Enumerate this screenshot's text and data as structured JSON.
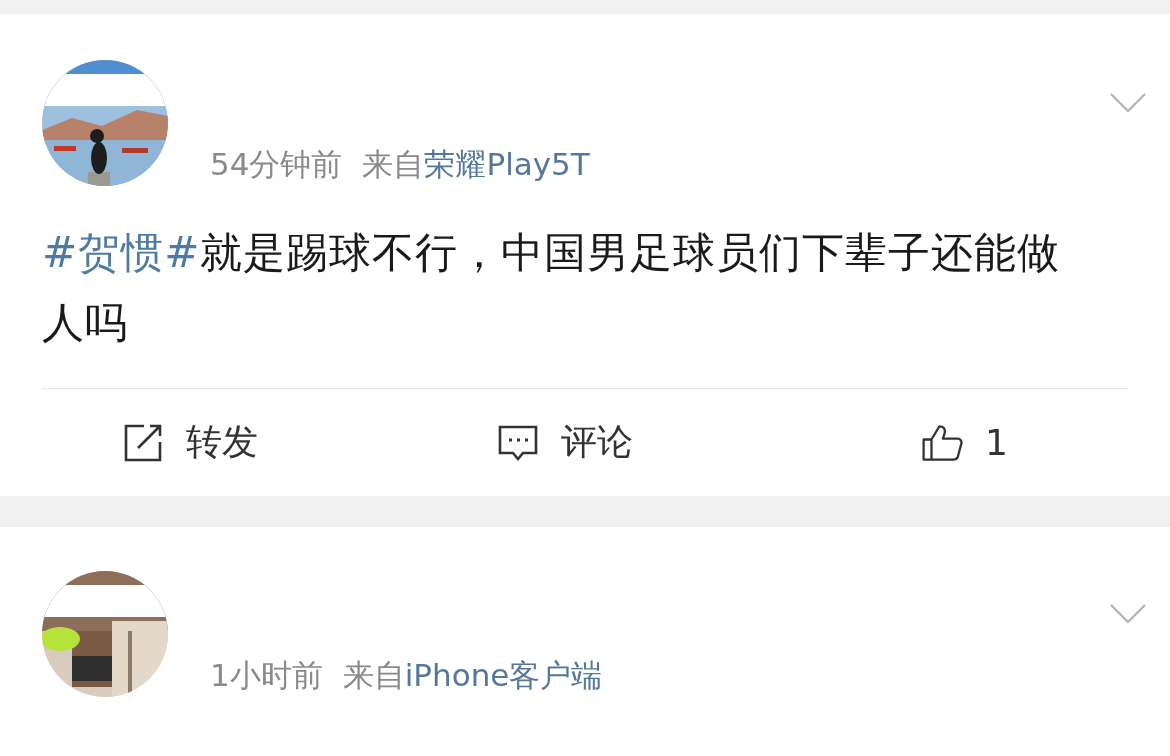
{
  "posts": [
    {
      "time": "54分钟前",
      "source_prefix": "来自",
      "source": "荣耀Play5T",
      "text": [
        {
          "kind": "hashtag",
          "text": "#贺惯#"
        },
        {
          "kind": "plain",
          "text": "就是踢球不行，中国男足球员们下辈子还能做人吗"
        }
      ],
      "actions": [
        {
          "kind": "repost",
          "label": "转发"
        },
        {
          "kind": "comment",
          "label": "评论"
        },
        {
          "kind": "like",
          "label": "1"
        }
      ]
    },
    {
      "time": "1小时前",
      "source_prefix": "来自",
      "source": "iPhone客户端"
    }
  ]
}
